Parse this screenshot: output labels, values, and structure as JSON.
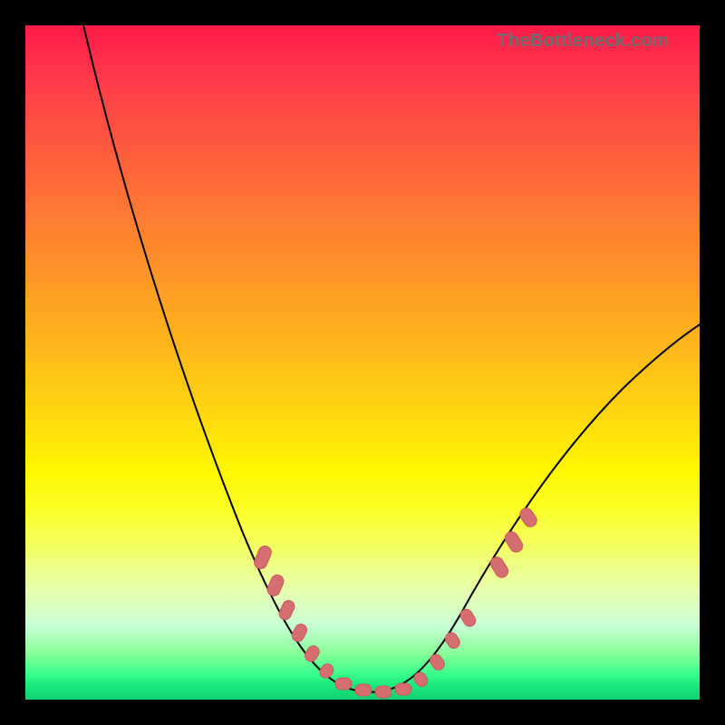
{
  "watermark": "TheBottleneck.com",
  "colors": {
    "frame": "#000000",
    "curve": "#000000",
    "bead": "#d66d71"
  },
  "chart_data": {
    "type": "line",
    "title": "",
    "xlabel": "",
    "ylabel": "",
    "xlim": [
      0,
      1
    ],
    "ylim": [
      0,
      1
    ],
    "x": [
      0.0,
      0.05,
      0.1,
      0.15,
      0.2,
      0.25,
      0.3,
      0.35,
      0.4,
      0.45,
      0.48,
      0.5,
      0.52,
      0.55,
      0.6,
      0.65,
      0.7,
      0.75,
      0.8,
      0.85,
      0.9,
      0.95,
      1.0
    ],
    "values": [
      1.08,
      1.0,
      0.9,
      0.78,
      0.64,
      0.5,
      0.36,
      0.23,
      0.12,
      0.05,
      0.02,
      0.01,
      0.02,
      0.05,
      0.12,
      0.2,
      0.28,
      0.35,
      0.41,
      0.47,
      0.52,
      0.56,
      0.59
    ],
    "markers": {
      "note": "pill-shaped beads along the curve near the valley region",
      "left_branch_y_range": [
        0.05,
        0.25
      ],
      "right_branch_y_range": [
        0.05,
        0.25
      ],
      "flat_bottom_y": 0.01
    },
    "annotations": [
      {
        "text": "TheBottleneck.com",
        "pos": "top-right"
      }
    ]
  }
}
